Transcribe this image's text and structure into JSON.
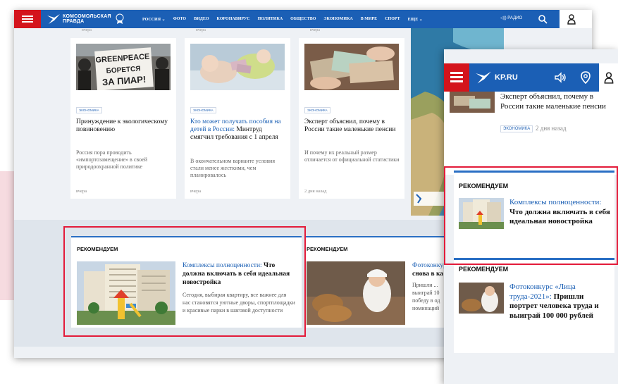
{
  "desktop": {
    "logo_line1": "КОМСОМОЛЬСКАЯ",
    "logo_line2": "ПРАВДА",
    "nav": [
      "РОССИЯ ⌄",
      "ФОТО",
      "ВИДЕО",
      "КОРОНАВИРУС",
      "ПОЛИТИКА",
      "ОБЩЕСТВО",
      "ЭКОНОМИКА",
      "В МИРЕ",
      "СПОРТ",
      "ЕЩЕ ⌄"
    ],
    "radio_label": "РАДИО",
    "cut_texts": [
      "вчера",
      "вчера",
      "вчера"
    ],
    "cards": [
      {
        "tag": "ЭКОНОМИКА",
        "title_link": "",
        "title": "Принуждение к экологическому повиновению",
        "desc": "Россия пора проводить «импортозамещение» в своей природоохранной политике",
        "date": "вчера",
        "poster_text": "GREENPEACE БОРЕТСЯ ЗА ПИАР!"
      },
      {
        "tag": "ЭКОНОМИКА",
        "title_link": "Кто может получать пособия на детей в России:",
        "title": "Минтруд смягчил требования с 1 апреля",
        "desc": "В окончательном варианте условия стали менее жесткими, чем планировалось",
        "date": "вчера"
      },
      {
        "tag": "ЭКОНОМИКА",
        "title_link": "",
        "title": "Эксперт объяснил, почему в России такие маленькие пенсии",
        "desc": "И почему их реальный размер отличается от официальной статистики",
        "date": "2 дня назад"
      }
    ],
    "rec_label": "РЕКОМЕНДУЕМ",
    "rec1": {
      "title_link": "Комплексы полноценности:",
      "title": "Что должна включать в себя идеальная новостройка",
      "desc": "Сегодня, выбирая квартиру, все важнее для нас становятся уютные дворы, спортплощадки и красивые парки в шаговой доступности"
    },
    "rec2": {
      "title_link": "Фотоконкурс",
      "title": "снова в ка",
      "desc": "Пришли ... выиграй 10 победу в од номинаций"
    }
  },
  "mobile": {
    "logo": "KP.RU",
    "news_title": "Эксперт объяснил, почему в России такие маленькие пенсии",
    "news_tag": "ЭКОНОМИКА",
    "news_date": "2 дня назад",
    "rec_label": "РЕКОМЕНДУЕМ",
    "rec1": {
      "title_link": "Комплексы полноценности:",
      "title": "Что должна включать в себя идеальная новостройка"
    },
    "rec2": {
      "title_link": "Фотоконкурс «Лица труда-2021»:",
      "title": "Пришли портрет человека труда и выиграй 100 000 рублей"
    }
  },
  "colors": {
    "brand_blue": "#1b5fb5",
    "menu_red": "#d4141c",
    "highlight": "#e31b3a",
    "link": "#1a5fb4"
  }
}
